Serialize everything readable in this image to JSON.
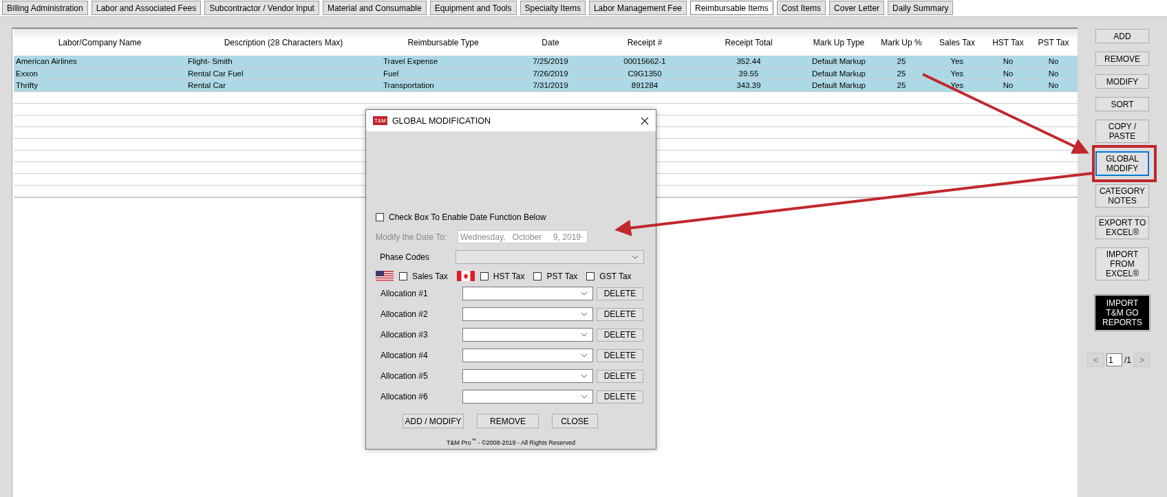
{
  "tabs": [
    {
      "label": "Billing Administration",
      "selected": false
    },
    {
      "label": "Labor and Associated Fees",
      "selected": false
    },
    {
      "label": "Subcontractor / Vendor Input",
      "selected": false
    },
    {
      "label": "Material and Consumable",
      "selected": false
    },
    {
      "label": "Equipment and Tools",
      "selected": false
    },
    {
      "label": "Specialty Items",
      "selected": false
    },
    {
      "label": "Labor Management Fee",
      "selected": false
    },
    {
      "label": "Reimbursable Items",
      "selected": true
    },
    {
      "label": "Cost Items",
      "selected": false
    },
    {
      "label": "Cover Letter",
      "selected": false
    },
    {
      "label": "Daily Summary",
      "selected": false
    }
  ],
  "table": {
    "columns": [
      "Labor/Company Name",
      "Description (28 Characters Max)",
      "Reimbursable Type",
      "Date",
      "Receipt #",
      "Receipt Total",
      "Mark Up Type",
      "Mark Up %",
      "Sales Tax",
      "HST Tax",
      "PST Tax"
    ],
    "rows": [
      {
        "selected": true,
        "cells": [
          "American Airlines",
          "Flight- Smith",
          "Travel Expense",
          "7/25/2019",
          "00015662-1",
          "352.44",
          "Default Markup",
          "25",
          "Yes",
          "No",
          "No"
        ]
      },
      {
        "selected": true,
        "cells": [
          "Exxon",
          "Rental Car Fuel",
          "Fuel",
          "7/26/2019",
          "C9G1350",
          "39.55",
          "Default Markup",
          "25",
          "Yes",
          "No",
          "No"
        ]
      },
      {
        "selected": true,
        "cells": [
          "Thrifty",
          "Rental Car",
          "Transportation",
          "7/31/2019",
          "891284",
          "343.39",
          "Default Markup",
          "25",
          "Yes",
          "No",
          "No"
        ]
      }
    ]
  },
  "side_buttons": [
    {
      "label": "ADD",
      "kind": "standard",
      "focused": false
    },
    {
      "label": "REMOVE",
      "kind": "standard",
      "focused": false
    },
    {
      "label": "MODIFY",
      "kind": "standard",
      "focused": false
    },
    {
      "label": "SORT",
      "kind": "standard",
      "focused": false
    },
    {
      "label": "COPY /\nPASTE",
      "kind": "standard",
      "focused": false
    },
    {
      "label": "GLOBAL\nMODIFY",
      "kind": "standard",
      "focused": true
    },
    {
      "label": "CATEGORY\nNOTES",
      "kind": "standard",
      "focused": false
    },
    {
      "label": "EXPORT TO\nEXCEL®",
      "kind": "standard",
      "focused": false
    },
    {
      "label": "IMPORT\nFROM\nEXCEL®",
      "kind": "standard",
      "focused": false
    },
    {
      "label": "IMPORT\nT&M GO\nREPORTS",
      "kind": "dark",
      "focused": false
    }
  ],
  "pager": {
    "prev": "<",
    "page": "1",
    "total": "/1",
    "next": ">"
  },
  "dialog": {
    "logo": "T&M",
    "title": "GLOBAL MODIFICATION",
    "date_checkbox": {
      "label": "Check Box To Enable Date Function Below",
      "checked": false
    },
    "date_field": {
      "label": "Modify the Date To:",
      "value": "Wednesday,   October     9, 2019",
      "disabled": true
    },
    "phase_codes": {
      "label": "Phase Codes"
    },
    "tax_groups": [
      {
        "kind": "us",
        "options": [
          {
            "label": "Sales Tax",
            "checked": false
          }
        ]
      },
      {
        "kind": "ca",
        "options": [
          {
            "label": "HST Tax",
            "checked": false
          },
          {
            "label": "PST Tax",
            "checked": false
          },
          {
            "label": "GST Tax",
            "checked": false
          }
        ]
      }
    ],
    "allocations": [
      {
        "label": "Allocation #1",
        "action": "DELETE"
      },
      {
        "label": "Allocation #2",
        "action": "DELETE"
      },
      {
        "label": "Allocation #3",
        "action": "DELETE"
      },
      {
        "label": "Allocation #4",
        "action": "DELETE"
      },
      {
        "label": "Allocation #5",
        "action": "DELETE"
      },
      {
        "label": "Allocation #6",
        "action": "DELETE"
      }
    ],
    "buttons": [
      "ADD / MODIFY",
      "REMOVE",
      "CLOSE"
    ],
    "footer": "T&M Pro$^{™}$ - ©2008-2019 - All Rights Reserved"
  }
}
